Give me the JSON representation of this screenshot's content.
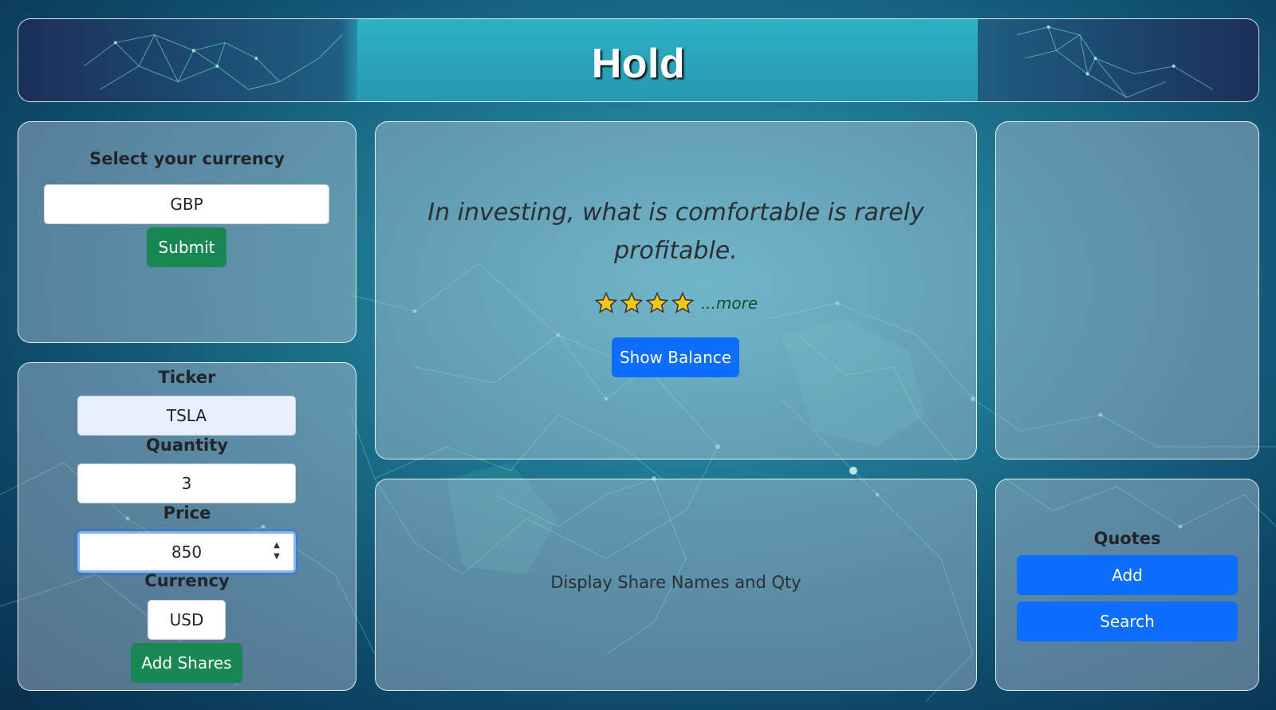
{
  "header": {
    "title": "Hold"
  },
  "currency_panel": {
    "heading": "Select your currency",
    "currency_value": "GBP",
    "submit_label": "Submit"
  },
  "add_panel": {
    "ticker_label": "Ticker",
    "ticker_value": "TSLA",
    "quantity_label": "Quantity",
    "quantity_value": "3",
    "price_label": "Price",
    "price_value": "850",
    "currency_label": "Currency",
    "currency_value": "USD",
    "add_shares_label": "Add Shares"
  },
  "quote_panel": {
    "quote": "In investing, what is comfortable is rarely profitable.",
    "rating_stars": 4,
    "more_label": "...more",
    "show_balance_label": "Show Balance"
  },
  "holdings_panel": {
    "placeholder": "Display Share Names and Qty"
  },
  "quotes_panel": {
    "heading": "Quotes",
    "add_label": "Add",
    "search_label": "Search"
  },
  "colors": {
    "green_button": "#198754",
    "blue_button": "#0d6efd",
    "panel_border": "#ffffff",
    "star_fill": "#f5c518"
  },
  "icons": [
    "star-icon",
    "spinner-up-icon",
    "spinner-down-icon"
  ]
}
